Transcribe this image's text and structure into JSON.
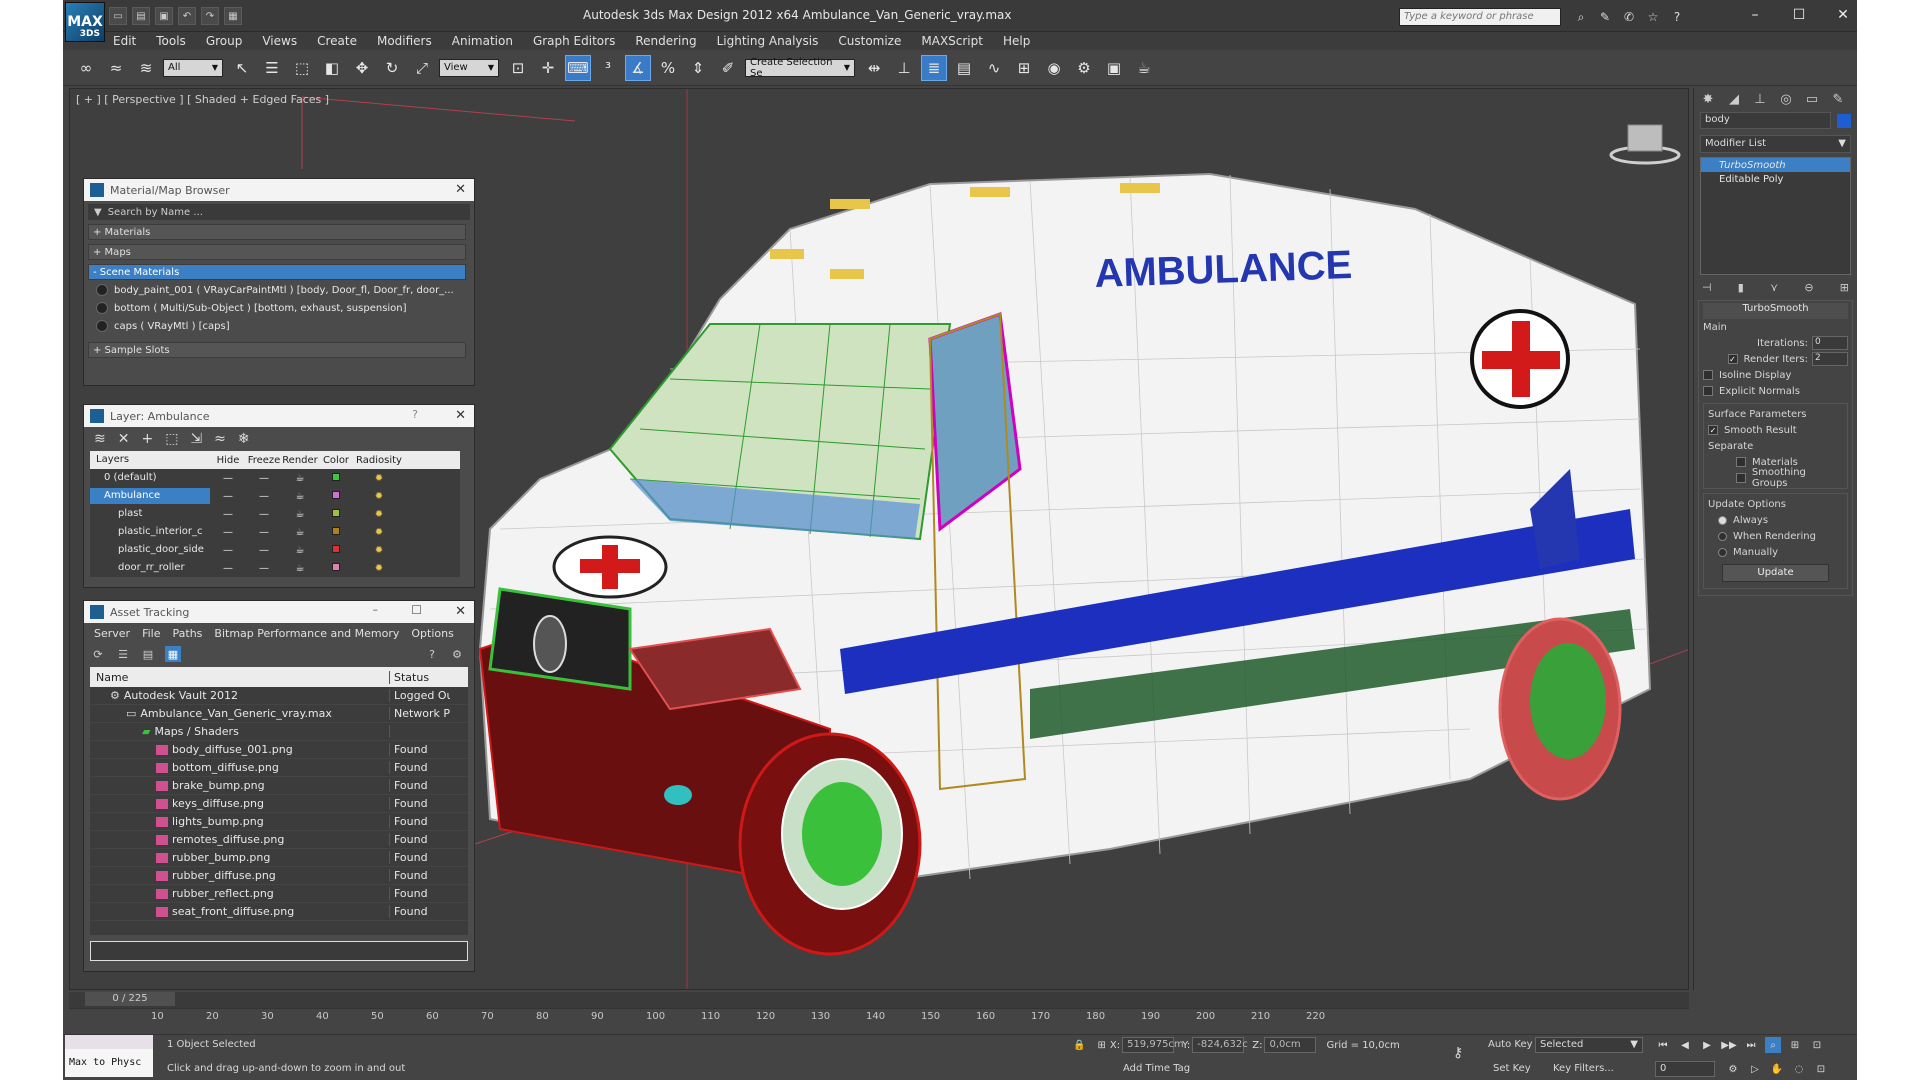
{
  "app": {
    "title": "Autodesk 3ds Max Design 2012 x64      Ambulance_Van_Generic_vray.max",
    "logo_text": "MAX",
    "logo_sub": "3DS",
    "search_placeholder": "Type a keyword or phrase"
  },
  "menu": [
    "Edit",
    "Tools",
    "Group",
    "Views",
    "Create",
    "Modifiers",
    "Animation",
    "Graph Editors",
    "Rendering",
    "Lighting Analysis",
    "Customize",
    "MAXScript",
    "Help"
  ],
  "toolbar": {
    "selection_filter": "All",
    "ref_coord": "View",
    "named_selection": "Create Selection Se"
  },
  "viewport": {
    "label": "[ + ] [ Perspective ] [ Shaded + Edged Faces ]",
    "vehicle_text": "AMBULANCE"
  },
  "material_browser": {
    "title": "Material/Map Browser",
    "search": "Search by Name ...",
    "sections": [
      "+ Materials",
      "+ Maps",
      "- Scene Materials",
      "+ Sample Slots"
    ],
    "materials": [
      "body_paint_001  ( VRayCarPaintMtl )  [body, Door_fl, Door_fr, door_...",
      "bottom  ( Multi/Sub-Object )  [bottom, exhaust, suspension]",
      "caps  ( VRayMtl )  [caps]"
    ]
  },
  "layer_panel": {
    "title": "Layer: Ambulance",
    "help": "?",
    "columns": [
      "Layers",
      "Hide",
      "Freeze",
      "Render",
      "Color",
      "Radiosity"
    ],
    "rows": [
      {
        "name": "0 (default)",
        "color": "#3cc83c"
      },
      {
        "name": "Ambulance",
        "color": "#d070d0"
      },
      {
        "name": "plast",
        "color": "#a0c040"
      },
      {
        "name": "plastic_interior_c",
        "color": "#b08020"
      },
      {
        "name": "plastic_door_side",
        "color": "#e03030"
      },
      {
        "name": "door_rr_roller",
        "color": "#e080b0"
      }
    ]
  },
  "asset_tracking": {
    "title": "Asset Tracking",
    "menu": [
      "Server",
      "File",
      "Paths",
      "Bitmap Performance and Memory",
      "Options"
    ],
    "columns": [
      "Name",
      "Status"
    ],
    "rows": [
      {
        "name": "Autodesk Vault 2012",
        "status": "Logged Out"
      },
      {
        "name": "Ambulance_Van_Generic_vray.max",
        "status": "Network Pa"
      },
      {
        "name": "Maps / Shaders",
        "status": ""
      },
      {
        "name": "body_diffuse_001.png",
        "status": "Found"
      },
      {
        "name": "bottom_diffuse.png",
        "status": "Found"
      },
      {
        "name": "brake_bump.png",
        "status": "Found"
      },
      {
        "name": "keys_diffuse.png",
        "status": "Found"
      },
      {
        "name": "lights_bump.png",
        "status": "Found"
      },
      {
        "name": "remotes_diffuse.png",
        "status": "Found"
      },
      {
        "name": "rubber_bump.png",
        "status": "Found"
      },
      {
        "name": "rubber_diffuse.png",
        "status": "Found"
      },
      {
        "name": "rubber_reflect.png",
        "status": "Found"
      },
      {
        "name": "seat_front_diffuse.png",
        "status": "Found"
      }
    ]
  },
  "command_panel": {
    "object_name": "body",
    "modifier_list": "Modifier List",
    "stack": [
      "TurboSmooth",
      "Editable Poly"
    ],
    "rollout_title": "TurboSmooth",
    "main_label": "Main",
    "iterations_label": "Iterations:",
    "iterations": "0",
    "render_iters_label": "Render Iters:",
    "render_iters": "2",
    "isoline": "Isoline Display",
    "explicit_normals": "Explicit Normals",
    "surface_params": "Surface Parameters",
    "smooth_result": "Smooth Result",
    "separate": "Separate",
    "materials": "Materials",
    "smoothing_groups": "Smoothing Groups",
    "update_options": "Update Options",
    "always": "Always",
    "when_rendering": "When Rendering",
    "manually": "Manually",
    "update_btn": "Update"
  },
  "timeline": {
    "frame": "0 / 225",
    "ticks": [
      "10",
      "20",
      "30",
      "40",
      "50",
      "60",
      "70",
      "80",
      "90",
      "100",
      "110",
      "120",
      "130",
      "140",
      "150",
      "160",
      "170",
      "180",
      "190",
      "200",
      "210",
      "220"
    ]
  },
  "status": {
    "maxscript": "Max to Physc",
    "selected": "1 Object Selected",
    "prompt": "Click and drag up-and-down to zoom in and out",
    "x_label": "X:",
    "x": "519,975cm",
    "y_label": "Y:",
    "y": "-824,632c",
    "z_label": "Z:",
    "z": "0,0cm",
    "grid": "Grid = 10,0cm",
    "auto_key": "Auto Key",
    "auto_key_mode": "Selected",
    "set_key": "Set Key",
    "key_filters": "Key Filters...",
    "add_time_tag": "Add Time Tag",
    "frame_field": "0"
  }
}
